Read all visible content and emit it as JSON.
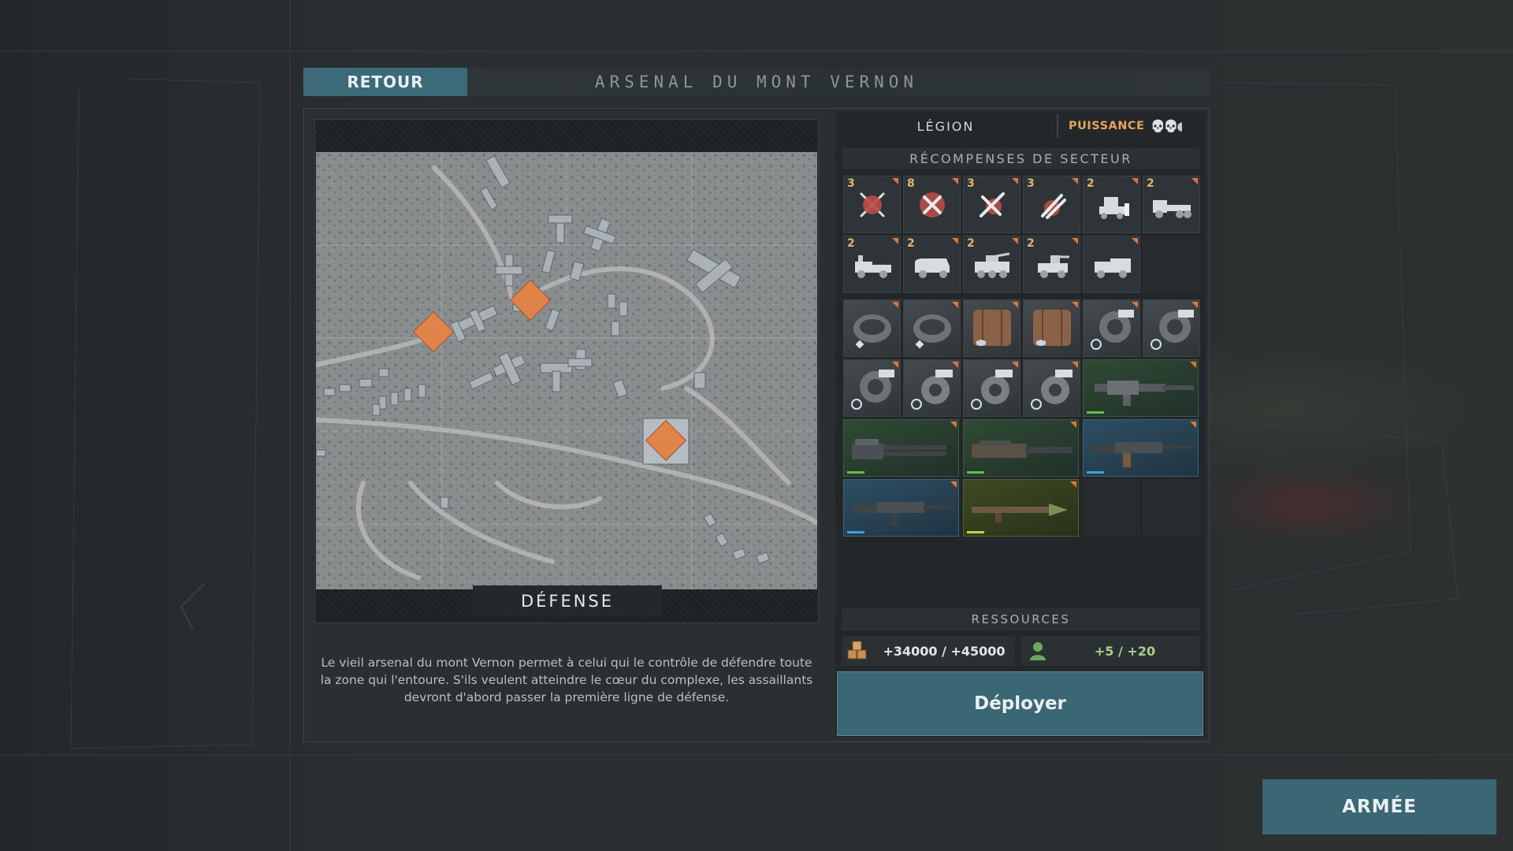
{
  "header": {
    "back_label": "RETOUR",
    "sector_title": "ARSENAL DU MONT VERNON"
  },
  "map": {
    "mode_label": "DÉFENSE",
    "description": "Le vieil arsenal du mont Vernon permet à celui qui le contrôle de défendre toute la zone qui l'entoure. S'ils veulent atteindre le cœur du complexe, les assaillants devront d'abord passer la première ligne de défense.",
    "objective_color": "#e0834a"
  },
  "faction": {
    "tab_label": "LÉGION",
    "power_label": "PUISSANCE",
    "power_icons": "💀💀◖"
  },
  "rewards": {
    "header": "RÉCOMPENSES DE SECTEUR",
    "vehicle_rows": [
      [
        {
          "qty": "3",
          "icon": "crossed-rifles-icon"
        },
        {
          "qty": "8",
          "icon": "crossed-tools-icon"
        },
        {
          "qty": "3",
          "icon": "crossed-sword-icon"
        },
        {
          "qty": "3",
          "icon": "rockets-icon"
        },
        {
          "qty": "2",
          "icon": "bulldozer-icon"
        },
        {
          "qty": "2",
          "icon": "truck-cab-icon"
        }
      ],
      [
        {
          "qty": "2",
          "icon": "pickup-truck-icon"
        },
        {
          "qty": "2",
          "icon": "van-icon"
        },
        {
          "qty": "2",
          "icon": "armored-car-icon"
        },
        {
          "qty": "2",
          "icon": "turret-jeep-icon"
        },
        {
          "qty": "",
          "icon": "utility-truck-icon"
        }
      ]
    ],
    "parts_rows": [
      [
        "cabin-part-icon",
        "cabin-part-icon",
        "armor-plate-icon",
        "armor-plate-icon",
        "engine-part-icon",
        "engine-part-icon"
      ],
      [
        "engine-part-icon",
        "turbo-part-icon",
        "turbo-part-icon",
        "turbo-part-icon"
      ]
    ],
    "weapons": [
      {
        "icon": "heavy-cannon-icon",
        "rarity": "green"
      },
      {
        "icon": "minigun-icon",
        "rarity": "green"
      },
      {
        "icon": "autocannon-icon",
        "rarity": "green"
      },
      {
        "icon": "assault-rifle-icon",
        "rarity": "blue"
      },
      {
        "icon": "machine-gun-icon",
        "rarity": "blue"
      },
      {
        "icon": "rocket-launcher-icon",
        "rarity": "olive"
      }
    ],
    "rarity_colors": {
      "green": "#5fbf48",
      "blue": "#3fa0e0",
      "olive": "#bcd24a"
    }
  },
  "resources": {
    "header": "RESSOURCES",
    "money_icon": "supply-crates-icon",
    "money": "+34000 / +45000",
    "men_icon": "soldier-icon",
    "men": "+5 / +20"
  },
  "actions": {
    "deploy_label": "Déployer",
    "army_label": "ARMÉE"
  }
}
